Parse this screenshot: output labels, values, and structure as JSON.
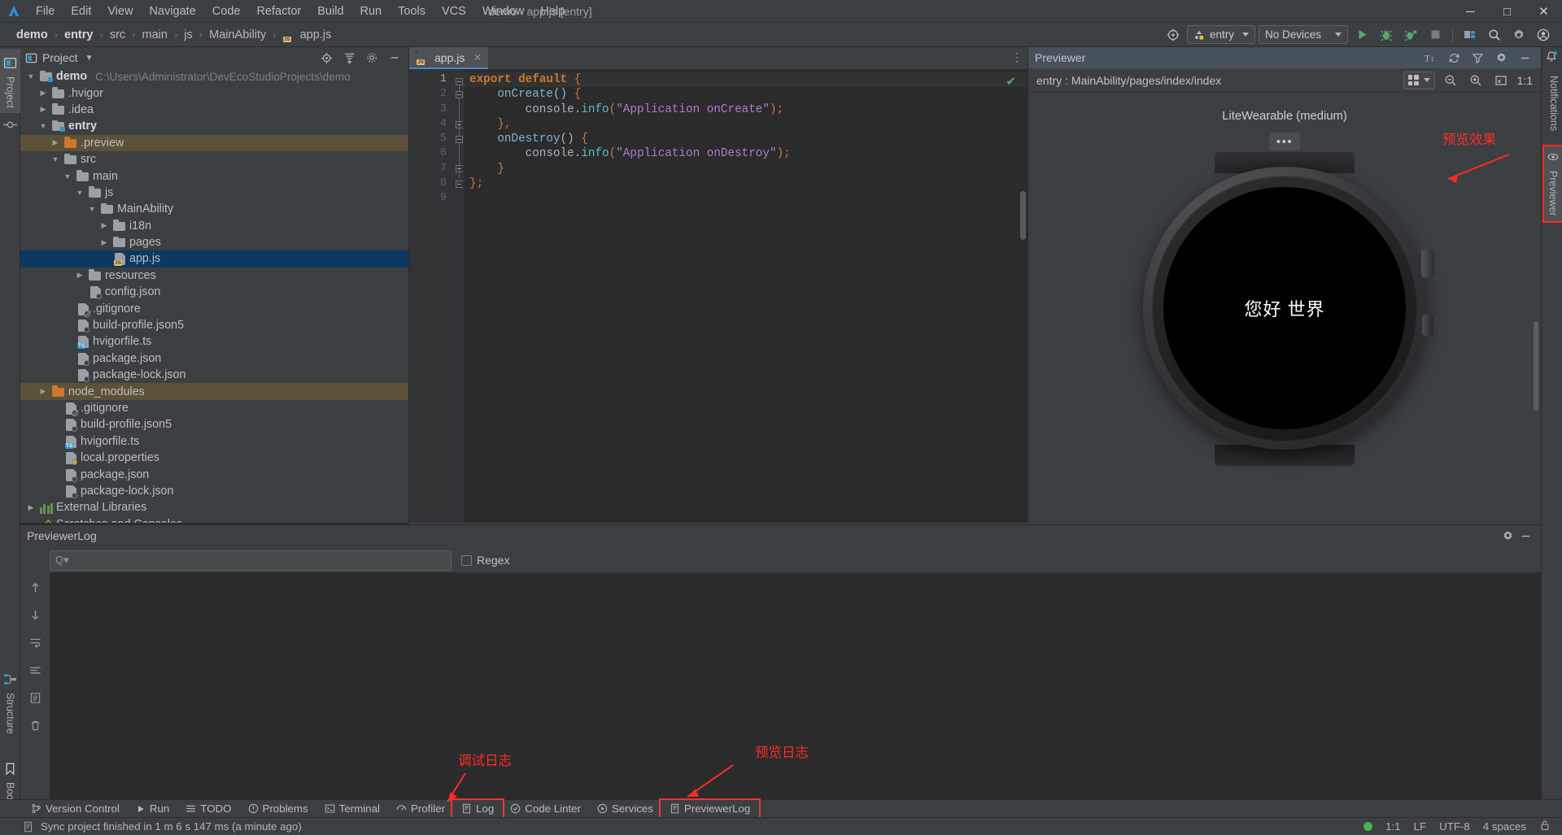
{
  "window": {
    "title": "demo - app.js [entry]",
    "menus": [
      "File",
      "Edit",
      "View",
      "Navigate",
      "Code",
      "Refactor",
      "Build",
      "Run",
      "Tools",
      "VCS",
      "Window",
      "Help"
    ],
    "controls": {
      "minimize": "─",
      "maximize": "□",
      "close": "✕"
    }
  },
  "breadcrumb": {
    "items": [
      "demo",
      "entry",
      "src",
      "main",
      "js",
      "MainAbility",
      "app.js"
    ],
    "separator": "›"
  },
  "toolbar": {
    "run_config": "entry",
    "device": "No Devices",
    "icons": [
      "target-icon",
      "run-icon",
      "debug-icon",
      "profile-icon",
      "stop-icon",
      "project-structure-icon",
      "search-icon",
      "settings-icon",
      "account-icon"
    ]
  },
  "left_rail": {
    "project_tab": "Project",
    "structure_tab": "Structure",
    "bookmarks_tab": "Bookmarks"
  },
  "right_rail": {
    "previewer_tab": "Previewer",
    "notifications_tab": "Notifications"
  },
  "project_panel": {
    "title": "Project",
    "header_icons": [
      "locate-icon",
      "collapse-all-icon",
      "settings-icon",
      "hide-icon"
    ],
    "tree": [
      {
        "indent": 0,
        "arrow": "down",
        "icon": "folder-module",
        "label": "demo",
        "bold": true,
        "path": "C:\\Users\\Administrator\\DevEcoStudioProjects\\demo"
      },
      {
        "indent": 1,
        "arrow": "right",
        "icon": "folder",
        "label": ".hvigor"
      },
      {
        "indent": 1,
        "arrow": "right",
        "icon": "folder",
        "label": ".idea"
      },
      {
        "indent": 1,
        "arrow": "down",
        "icon": "folder-module",
        "label": "entry",
        "bold": true
      },
      {
        "indent": 2,
        "arrow": "right",
        "icon": "folder-orange",
        "label": ".preview",
        "highlight": "preview"
      },
      {
        "indent": 2,
        "arrow": "down",
        "icon": "folder",
        "label": "src"
      },
      {
        "indent": 3,
        "arrow": "down",
        "icon": "folder",
        "label": "main"
      },
      {
        "indent": 4,
        "arrow": "down",
        "icon": "folder",
        "label": "js"
      },
      {
        "indent": 5,
        "arrow": "down",
        "icon": "folder",
        "label": "MainAbility"
      },
      {
        "indent": 6,
        "arrow": "right",
        "icon": "folder",
        "label": "i18n"
      },
      {
        "indent": 6,
        "arrow": "right",
        "icon": "folder",
        "label": "pages"
      },
      {
        "indent": 6,
        "arrow": "none",
        "icon": "file-js",
        "label": "app.js",
        "highlight": "selected"
      },
      {
        "indent": 4,
        "arrow": "right",
        "icon": "folder",
        "label": "resources"
      },
      {
        "indent": 4,
        "arrow": "none",
        "icon": "file-json",
        "label": "config.json"
      },
      {
        "indent": 3,
        "arrow": "none",
        "icon": "file-ignore",
        "label": ".gitignore"
      },
      {
        "indent": 3,
        "arrow": "none",
        "icon": "file-json",
        "label": "build-profile.json5"
      },
      {
        "indent": 3,
        "arrow": "none",
        "icon": "file-ts",
        "label": "hvigorfile.ts"
      },
      {
        "indent": 3,
        "arrow": "none",
        "icon": "file-json",
        "label": "package.json"
      },
      {
        "indent": 3,
        "arrow": "none",
        "icon": "file-json",
        "label": "package-lock.json"
      },
      {
        "indent": 1,
        "arrow": "right",
        "icon": "folder-orange",
        "label": "node_modules",
        "highlight": "preview"
      },
      {
        "indent": 2,
        "arrow": "none",
        "icon": "file-ignore",
        "label": ".gitignore"
      },
      {
        "indent": 2,
        "arrow": "none",
        "icon": "file-json",
        "label": "build-profile.json5"
      },
      {
        "indent": 2,
        "arrow": "none",
        "icon": "file-ts",
        "label": "hvigorfile.ts"
      },
      {
        "indent": 2,
        "arrow": "none",
        "icon": "file-props",
        "label": "local.properties"
      },
      {
        "indent": 2,
        "arrow": "none",
        "icon": "file-json",
        "label": "package.json"
      },
      {
        "indent": 2,
        "arrow": "none",
        "icon": "file-json",
        "label": "package-lock.json"
      },
      {
        "indent": 0,
        "arrow": "right",
        "icon": "library",
        "label": "External Libraries"
      },
      {
        "indent": 0,
        "arrow": "none",
        "icon": "scratch",
        "label": "Scratches and Consoles"
      }
    ]
  },
  "editor": {
    "tab_label": "app.js",
    "tab_close": "✕",
    "kebab": "⋮",
    "line_numbers": [
      "1",
      "2",
      "3",
      "4",
      "5",
      "6",
      "7",
      "8",
      "9"
    ],
    "lines": [
      [
        {
          "t": "export",
          "c": "kw"
        },
        {
          "t": " ",
          "c": "pl"
        },
        {
          "t": "default",
          "c": "kw"
        },
        {
          "t": " ",
          "c": "pl"
        },
        {
          "t": "{",
          "c": "punc"
        }
      ],
      [
        {
          "t": "    ",
          "c": "pl"
        },
        {
          "t": "onCreate",
          "c": "fn"
        },
        {
          "t": "()",
          "c": "br"
        },
        {
          "t": " ",
          "c": "pl"
        },
        {
          "t": "{",
          "c": "punc"
        }
      ],
      [
        {
          "t": "        ",
          "c": "pl"
        },
        {
          "t": "console",
          "c": "pl"
        },
        {
          "t": ".",
          "c": "pl"
        },
        {
          "t": "info",
          "c": "method"
        },
        {
          "t": "(",
          "c": "punc"
        },
        {
          "t": "\"Application onCreate\"",
          "c": "str"
        },
        {
          "t": ")",
          "c": "punc"
        },
        {
          "t": ";",
          "c": "punc"
        }
      ],
      [
        {
          "t": "    ",
          "c": "pl"
        },
        {
          "t": "}",
          "c": "punc"
        },
        {
          "t": ",",
          "c": "punc"
        }
      ],
      [
        {
          "t": "    ",
          "c": "pl"
        },
        {
          "t": "onDestroy",
          "c": "fn"
        },
        {
          "t": "()",
          "c": "br"
        },
        {
          "t": " ",
          "c": "pl"
        },
        {
          "t": "{",
          "c": "punc"
        }
      ],
      [
        {
          "t": "        ",
          "c": "pl"
        },
        {
          "t": "console",
          "c": "pl"
        },
        {
          "t": ".",
          "c": "pl"
        },
        {
          "t": "info",
          "c": "method"
        },
        {
          "t": "(",
          "c": "punc"
        },
        {
          "t": "\"Application onDestroy\"",
          "c": "str"
        },
        {
          "t": ")",
          "c": "punc"
        },
        {
          "t": ";",
          "c": "punc"
        }
      ],
      [
        {
          "t": "    ",
          "c": "pl"
        },
        {
          "t": "}",
          "c": "punc"
        }
      ],
      [
        {
          "t": "}",
          "c": "punc"
        },
        {
          "t": ";",
          "c": "punc"
        }
      ],
      []
    ]
  },
  "previewer": {
    "title": "Previewer",
    "header_icons": [
      "text-size-icon",
      "refresh-icon",
      "funnel-icon",
      "gear-icon",
      "minimize-icon"
    ],
    "path": "entry : MainAbility/pages/index/index",
    "sub_icons": [
      "layout-grid-icon",
      "zoom-out-icon",
      "zoom-in-icon",
      "fit-screen-icon"
    ],
    "zoom_level": "1:1",
    "device_label": "LiteWearable (medium)",
    "more_button": "•••",
    "screen_text": "您好 世界"
  },
  "log_panel": {
    "title": "PreviewerLog",
    "header_icons": [
      "gear-icon",
      "minimize-icon"
    ],
    "search_placeholder": "Q▾",
    "regex_label": "Regex",
    "sidebar_icons": [
      "scroll-up-icon",
      "scroll-down-icon",
      "soft-wrap-icon",
      "console-icon",
      "export-icon",
      "trash-icon"
    ]
  },
  "bottom_tabs": [
    {
      "label": "Version Control",
      "icon": "branch-icon",
      "boxed": false
    },
    {
      "label": "Run",
      "icon": "play-icon",
      "boxed": false
    },
    {
      "label": "TODO",
      "icon": "list-icon",
      "boxed": false
    },
    {
      "label": "Problems",
      "icon": "warning-icon",
      "boxed": false
    },
    {
      "label": "Terminal",
      "icon": "terminal-icon",
      "boxed": false
    },
    {
      "label": "Profiler",
      "icon": "profiler-icon",
      "boxed": false
    },
    {
      "label": "Log",
      "icon": "log-icon",
      "boxed": true
    },
    {
      "label": "Code Linter",
      "icon": "linter-icon",
      "boxed": false
    },
    {
      "label": "Services",
      "icon": "services-icon",
      "boxed": false
    },
    {
      "label": "PreviewerLog",
      "icon": "previewerlog-icon",
      "boxed": true
    }
  ],
  "statusbar": {
    "message": "Sync project finished in 1 m 6 s 147 ms (a minute ago)",
    "caret": "1:1",
    "line_ending": "LF",
    "encoding": "UTF-8",
    "indent": "4 spaces",
    "lock_icon": "lock-icon"
  },
  "annotations": [
    {
      "id": "preview-effect",
      "text": "预览效果"
    },
    {
      "id": "debug-log",
      "text": "调试日志"
    },
    {
      "id": "preview-log",
      "text": "预览日志"
    }
  ],
  "colors": {
    "accent_blue": "#4a88c7",
    "annotation_red": "#ff2a2a",
    "selection_blue": "#0d385f",
    "highlight_tan": "#5b5139",
    "status_green": "#4caf50"
  }
}
